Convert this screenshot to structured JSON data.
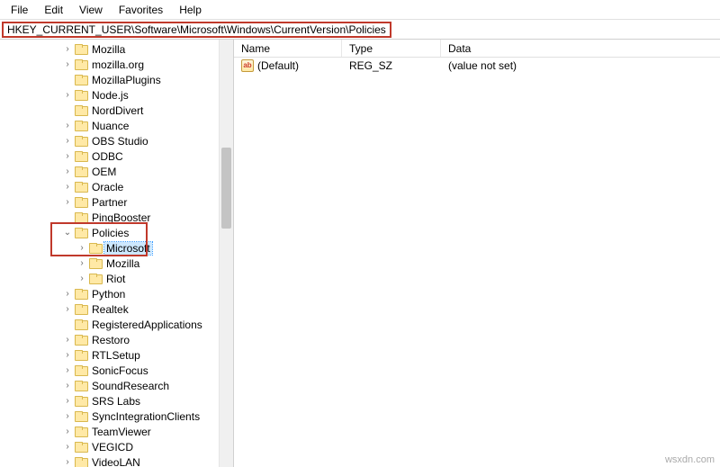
{
  "menubar": {
    "file": "File",
    "edit": "Edit",
    "view": "View",
    "favorites": "Favorites",
    "help": "Help"
  },
  "address": "HKEY_CURRENT_USER\\Software\\Microsoft\\Windows\\CurrentVersion\\Policies",
  "tree": {
    "items": [
      {
        "label": "Mozilla",
        "depth": 3,
        "exp": ">"
      },
      {
        "label": "mozilla.org",
        "depth": 3,
        "exp": ">"
      },
      {
        "label": "MozillaPlugins",
        "depth": 3,
        "exp": ""
      },
      {
        "label": "Node.js",
        "depth": 3,
        "exp": ">"
      },
      {
        "label": "NordDivert",
        "depth": 3,
        "exp": ""
      },
      {
        "label": "Nuance",
        "depth": 3,
        "exp": ">"
      },
      {
        "label": "OBS Studio",
        "depth": 3,
        "exp": ">"
      },
      {
        "label": "ODBC",
        "depth": 3,
        "exp": ">"
      },
      {
        "label": "OEM",
        "depth": 3,
        "exp": ">"
      },
      {
        "label": "Oracle",
        "depth": 3,
        "exp": ">"
      },
      {
        "label": "Partner",
        "depth": 3,
        "exp": ">"
      },
      {
        "label": "PingBooster",
        "depth": 3,
        "exp": ""
      },
      {
        "label": "Policies",
        "depth": 3,
        "exp": "v"
      },
      {
        "label": "Microsoft",
        "depth": 4,
        "exp": ">",
        "selected": true
      },
      {
        "label": "Mozilla",
        "depth": 4,
        "exp": ">"
      },
      {
        "label": "Riot",
        "depth": 4,
        "exp": ">"
      },
      {
        "label": "Python",
        "depth": 3,
        "exp": ">"
      },
      {
        "label": "Realtek",
        "depth": 3,
        "exp": ">"
      },
      {
        "label": "RegisteredApplications",
        "depth": 3,
        "exp": ""
      },
      {
        "label": "Restoro",
        "depth": 3,
        "exp": ">"
      },
      {
        "label": "RTLSetup",
        "depth": 3,
        "exp": ">"
      },
      {
        "label": "SonicFocus",
        "depth": 3,
        "exp": ">"
      },
      {
        "label": "SoundResearch",
        "depth": 3,
        "exp": ">"
      },
      {
        "label": "SRS Labs",
        "depth": 3,
        "exp": ">"
      },
      {
        "label": "SyncIntegrationClients",
        "depth": 3,
        "exp": ">"
      },
      {
        "label": "TeamViewer",
        "depth": 3,
        "exp": ">"
      },
      {
        "label": "VEGICD",
        "depth": 3,
        "exp": ">"
      },
      {
        "label": "VideoLAN",
        "depth": 3,
        "exp": ">"
      }
    ]
  },
  "columns": {
    "name": "Name",
    "type": "Type",
    "data": "Data"
  },
  "values": [
    {
      "name": "(Default)",
      "type": "REG_SZ",
      "data": "(value not set)",
      "icon": "ab"
    }
  ],
  "watermark": "wsxdn.com"
}
